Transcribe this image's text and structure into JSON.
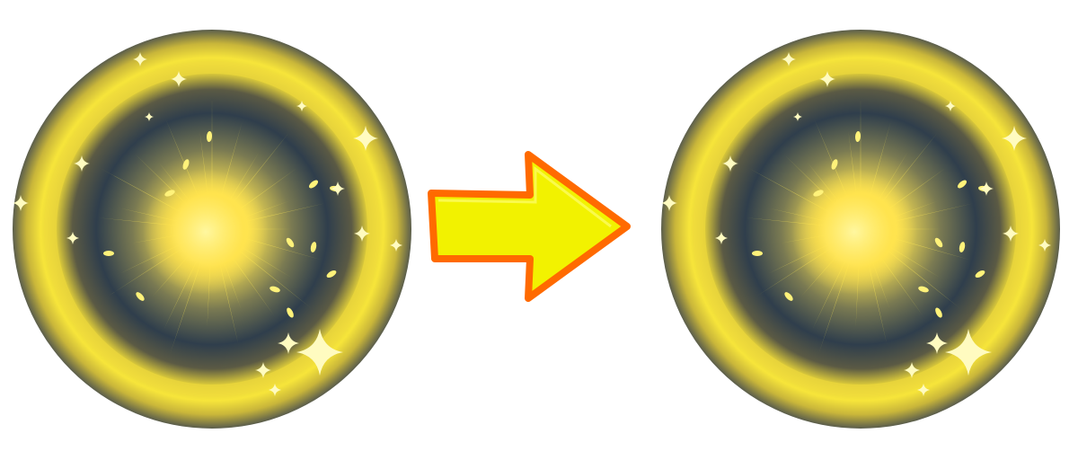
{
  "scene": {
    "background": "#ffffff",
    "items": [
      {
        "kind": "orb",
        "name": "glowing-orb-before"
      },
      {
        "kind": "arrow",
        "name": "right-arrow"
      },
      {
        "kind": "orb",
        "name": "glowing-orb-after"
      }
    ]
  },
  "colors": {
    "orb_rim_dark": "#5a5d4c",
    "orb_ring_yellow": "#f7e53a",
    "orb_inner_dark": "#2f3e4c",
    "orb_core": "#fff066",
    "sparkle": "#fff27a",
    "arrow_fill": "#f2f200",
    "arrow_stroke": "#ff6a00"
  }
}
